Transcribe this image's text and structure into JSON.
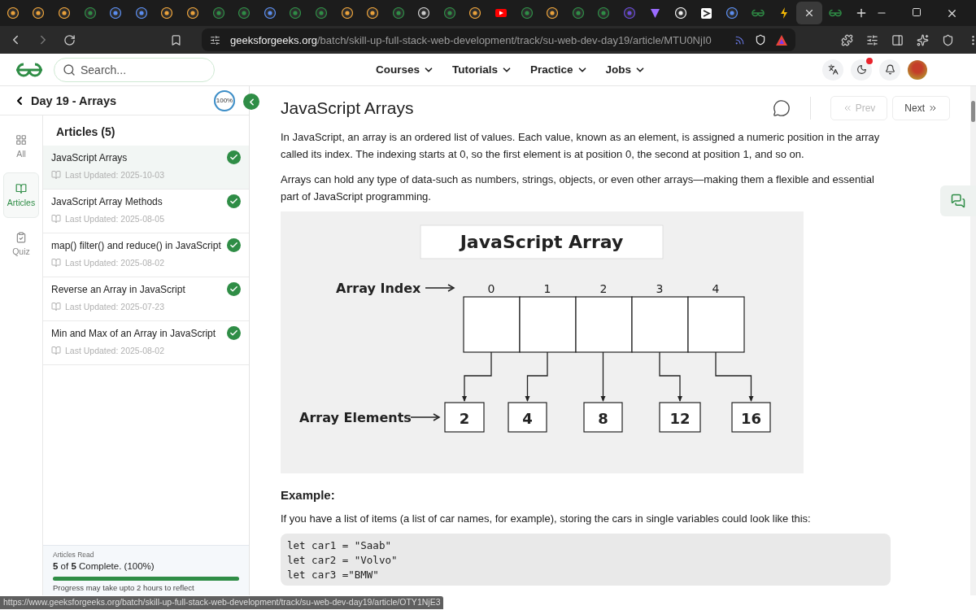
{
  "browser": {
    "tabs": [
      {
        "kind": "orange",
        "selected": false
      },
      {
        "kind": "orange",
        "selected": false
      },
      {
        "kind": "orange",
        "selected": false
      },
      {
        "kind": "green",
        "selected": false
      },
      {
        "kind": "blue",
        "selected": false
      },
      {
        "kind": "blue",
        "selected": false
      },
      {
        "kind": "orange",
        "selected": false
      },
      {
        "kind": "orange",
        "selected": false
      },
      {
        "kind": "green",
        "selected": false
      },
      {
        "kind": "green",
        "selected": false
      },
      {
        "kind": "blue",
        "selected": false
      },
      {
        "kind": "green",
        "selected": false
      },
      {
        "kind": "green",
        "selected": false
      },
      {
        "kind": "orange",
        "selected": false
      },
      {
        "kind": "orange",
        "selected": false
      },
      {
        "kind": "green",
        "selected": false
      },
      {
        "kind": "ai",
        "selected": false
      },
      {
        "kind": "green",
        "selected": false
      },
      {
        "kind": "orange",
        "selected": false
      },
      {
        "kind": "red",
        "selected": false
      },
      {
        "kind": "green",
        "selected": false
      },
      {
        "kind": "orange",
        "selected": false
      },
      {
        "kind": "green",
        "selected": false
      },
      {
        "kind": "green",
        "selected": false
      },
      {
        "kind": "code",
        "selected": false
      },
      {
        "kind": "vite",
        "selected": false
      },
      {
        "kind": "github",
        "selected": false
      },
      {
        "kind": "dark",
        "selected": false
      },
      {
        "kind": "blue",
        "selected": false
      },
      {
        "kind": "gfg",
        "selected": false
      },
      {
        "kind": "bolt",
        "selected": false
      },
      {
        "selected": true
      },
      {
        "kind": "gfg",
        "selected": false
      }
    ],
    "address_host": "geeksforgeeks.org",
    "address_path": "/batch/skill-up-full-stack-web-development/track/su-web-dev-day19/article/MTU0NjI0"
  },
  "header": {
    "search_placeholder": "Search...",
    "nav": [
      "Courses",
      "Tutorials",
      "Practice",
      "Jobs"
    ],
    "theme_notification": true
  },
  "sidebar": {
    "title": "Day 19 - Arrays",
    "ring": {
      "text": "100%",
      "level": 1
    },
    "rail": [
      {
        "kind": "all",
        "label": "All",
        "selected": false
      },
      {
        "kind": "articles",
        "label": "Articles",
        "selected": true
      },
      {
        "kind": "quiz",
        "label": "Quiz",
        "selected": false
      }
    ],
    "list_title": "Articles (5)",
    "articles": [
      {
        "title": "JavaScript Arrays",
        "updated": "Last Updated: 2025-10-03",
        "selected": true,
        "completed": true
      },
      {
        "title": "JavaScript Array Methods",
        "updated": "Last Updated: 2025-08-05",
        "selected": false,
        "completed": true
      },
      {
        "title": "map() filter() and reduce() in JavaScript",
        "updated": "Last Updated: 2025-08-02",
        "selected": false,
        "completed": true
      },
      {
        "title": "Reverse an Array in JavaScript",
        "updated": "Last Updated: 2025-07-23",
        "selected": false,
        "completed": true
      },
      {
        "title": "Min and Max of an Array in JavaScript",
        "updated": "Last Updated: 2025-08-02",
        "selected": false,
        "completed": true
      }
    ],
    "summary": {
      "label": "Articles Read",
      "text": "**5** of **5** Complete. (100%)",
      "level": 1,
      "note": "Progress may take upto 2 hours to reflect"
    }
  },
  "article": {
    "title": "JavaScript Arrays",
    "prev": {
      "label": "Prev",
      "disabled": true
    },
    "next": {
      "label": "Next",
      "disabled": false
    },
    "paragraphs": [
      "In JavaScript, an array is an ordered list of values. Each value, known as an element, is assigned a numeric position in the array called its index. The indexing starts at 0, so the first element is at position 0, the second at position 1, and so on.",
      "Arrays can hold any type of data-such as numbers, strings, objects, or even other arrays—making them a flexible and essential part of JavaScript programming."
    ],
    "figure": {
      "title": "JavaScript Array",
      "index_label": "Array Index",
      "indices": [
        "0",
        "1",
        "2",
        "3",
        "4"
      ],
      "elements_label": "Array Elements",
      "elements": [
        "2",
        "4",
        "8",
        "12",
        "16"
      ]
    },
    "heading": "Example:",
    "example_text": "If you have a list of items (a list of car names, for example), storing the cars in single variables could look like this:",
    "code": [
      "let car1 = \"Saab\"",
      "let car2 = \"Volvo\"",
      "let car3 =\"BMW\""
    ]
  },
  "status_url": "https://www.geeksforgeeks.org/batch/skill-up-full-stack-web-development/track/su-web-dev-day19/article/OTY1NjE3"
}
